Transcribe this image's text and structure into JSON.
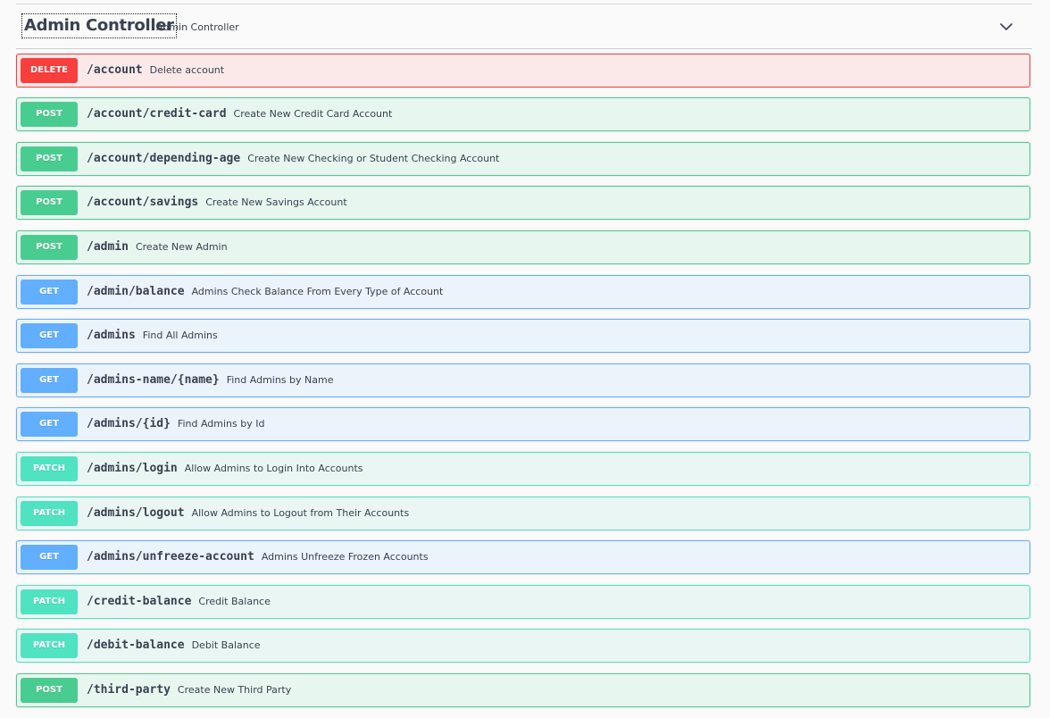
{
  "section": {
    "title": "Admin Controller",
    "description": "Admin Controller",
    "toggle_icon": "chevron-down-icon"
  },
  "operations": [
    {
      "method": "DELETE",
      "path": "/account",
      "summary": "Delete account"
    },
    {
      "method": "POST",
      "path": "/account/credit-card",
      "summary": "Create New Credit Card Account"
    },
    {
      "method": "POST",
      "path": "/account/depending-age",
      "summary": "Create New Checking or Student Checking Account"
    },
    {
      "method": "POST",
      "path": "/account/savings",
      "summary": "Create New Savings Account"
    },
    {
      "method": "POST",
      "path": "/admin",
      "summary": "Create New Admin"
    },
    {
      "method": "GET",
      "path": "/admin/balance",
      "summary": "Admins Check Balance From Every Type of Account"
    },
    {
      "method": "GET",
      "path": "/admins",
      "summary": "Find All Admins"
    },
    {
      "method": "GET",
      "path": "/admins-name/{name}",
      "summary": "Find Admins by Name"
    },
    {
      "method": "GET",
      "path": "/admins/{id}",
      "summary": "Find Admins by Id"
    },
    {
      "method": "PATCH",
      "path": "/admins/login",
      "summary": "Allow Admins to Login Into Accounts"
    },
    {
      "method": "PATCH",
      "path": "/admins/logout",
      "summary": "Allow Admins to Logout from Their Accounts"
    },
    {
      "method": "GET",
      "path": "/admins/unfreeze-account",
      "summary": "Admins Unfreeze Frozen Accounts"
    },
    {
      "method": "PATCH",
      "path": "/credit-balance",
      "summary": "Credit Balance"
    },
    {
      "method": "PATCH",
      "path": "/debit-balance",
      "summary": "Debit Balance"
    },
    {
      "method": "POST",
      "path": "/third-party",
      "summary": "Create New Third Party"
    }
  ],
  "colors": {
    "delete": "#f93e3e",
    "post": "#49cc90",
    "get": "#61affe",
    "patch": "#50e3c2"
  }
}
